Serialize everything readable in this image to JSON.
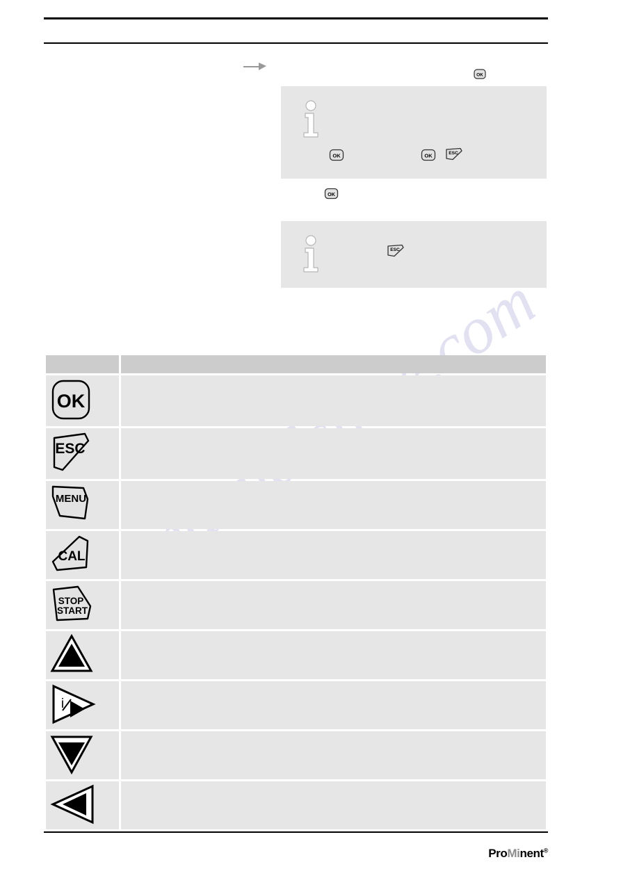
{
  "document": {
    "brand": {
      "part1": "Pro",
      "part2": "Mi",
      "part3": "nent",
      "registered": "®"
    },
    "watermark": "manualshive.com"
  },
  "header": {
    "left": "",
    "right": "",
    "subheader": ""
  },
  "margin_notes": [
    {
      "text": ""
    }
  ],
  "paragraphs": [
    {
      "text": ""
    },
    {
      "text": ""
    }
  ],
  "note_boxes": [
    {
      "icon": "info-icon",
      "text": "",
      "inline_keys": [
        "OK",
        "OK",
        "ESC"
      ]
    },
    {
      "icon": "info-icon",
      "text": "",
      "inline_keys": [
        "ESC"
      ]
    }
  ],
  "inline_keys": {
    "step_ok": "OK",
    "para_ok": "OK"
  },
  "key_table": {
    "columns": [
      {
        "header": ""
      },
      {
        "header": ""
      }
    ],
    "rows": [
      {
        "key": "OK",
        "key_style": "rounded",
        "description": ""
      },
      {
        "key": "ESC",
        "key_style": "esc",
        "description": ""
      },
      {
        "key": "MENU",
        "key_style": "menu",
        "description": ""
      },
      {
        "key": "CAL",
        "key_style": "cal",
        "description": ""
      },
      {
        "key": "STOP/START",
        "key_style": "stopstart",
        "description": ""
      },
      {
        "key": "UP",
        "key_style": "tri-up",
        "description": ""
      },
      {
        "key": "RIGHT-INFO",
        "key_style": "tri-right",
        "description": ""
      },
      {
        "key": "DOWN",
        "key_style": "tri-down",
        "description": ""
      },
      {
        "key": "LEFT",
        "key_style": "tri-left",
        "description": ""
      }
    ]
  },
  "footer": {
    "left": ""
  },
  "colors": {
    "note_box_bg": "#e6e6e6",
    "table_header_bg": "#cccccc",
    "table_cell_bg": "#e6e6e6",
    "key_fill": "#e3e3e3",
    "brand_gray": "#8c8c8c",
    "rule": "#000000"
  }
}
